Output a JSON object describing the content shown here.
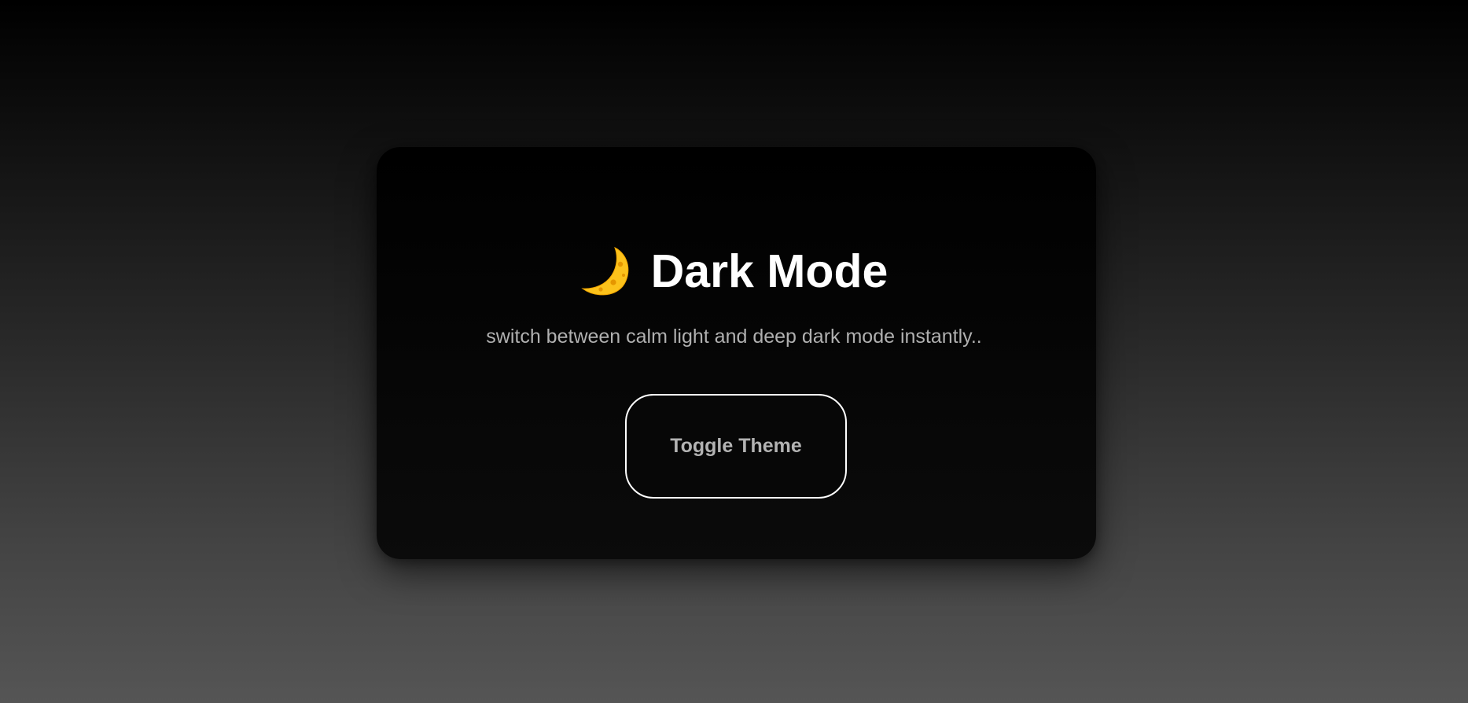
{
  "card": {
    "icon": "crescent-moon-icon",
    "title": "Dark Mode",
    "subtitle": "switch between calm light and deep dark mode instantly..",
    "button_label": "Toggle Theme"
  },
  "colors": {
    "icon_yellow": "#fcc21b",
    "title_text": "#ffffff",
    "subtitle_text": "#b0b0b0",
    "button_border": "#ffffff",
    "button_text": "#b3b3b3"
  }
}
